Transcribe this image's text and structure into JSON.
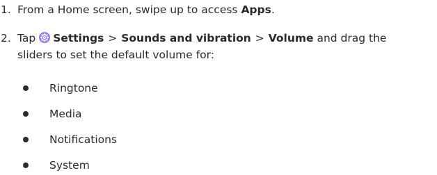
{
  "steps": [
    {
      "number": "1.",
      "pre": "From a Home screen, swipe up to access ",
      "bold": "Apps",
      "post": "."
    },
    {
      "number": "2.",
      "tap": "Tap",
      "settings": "Settings",
      "sep": ">",
      "sounds": "Sounds and vibration",
      "volume": "Volume",
      "post1": "and drag the",
      "line2": "sliders to set the default volume for:"
    }
  ],
  "bullets": [
    "Ringtone",
    "Media",
    "Notifications",
    "System"
  ],
  "icons": {
    "settings": "settings-gear-icon",
    "settings_color": "#9a7cf0"
  }
}
